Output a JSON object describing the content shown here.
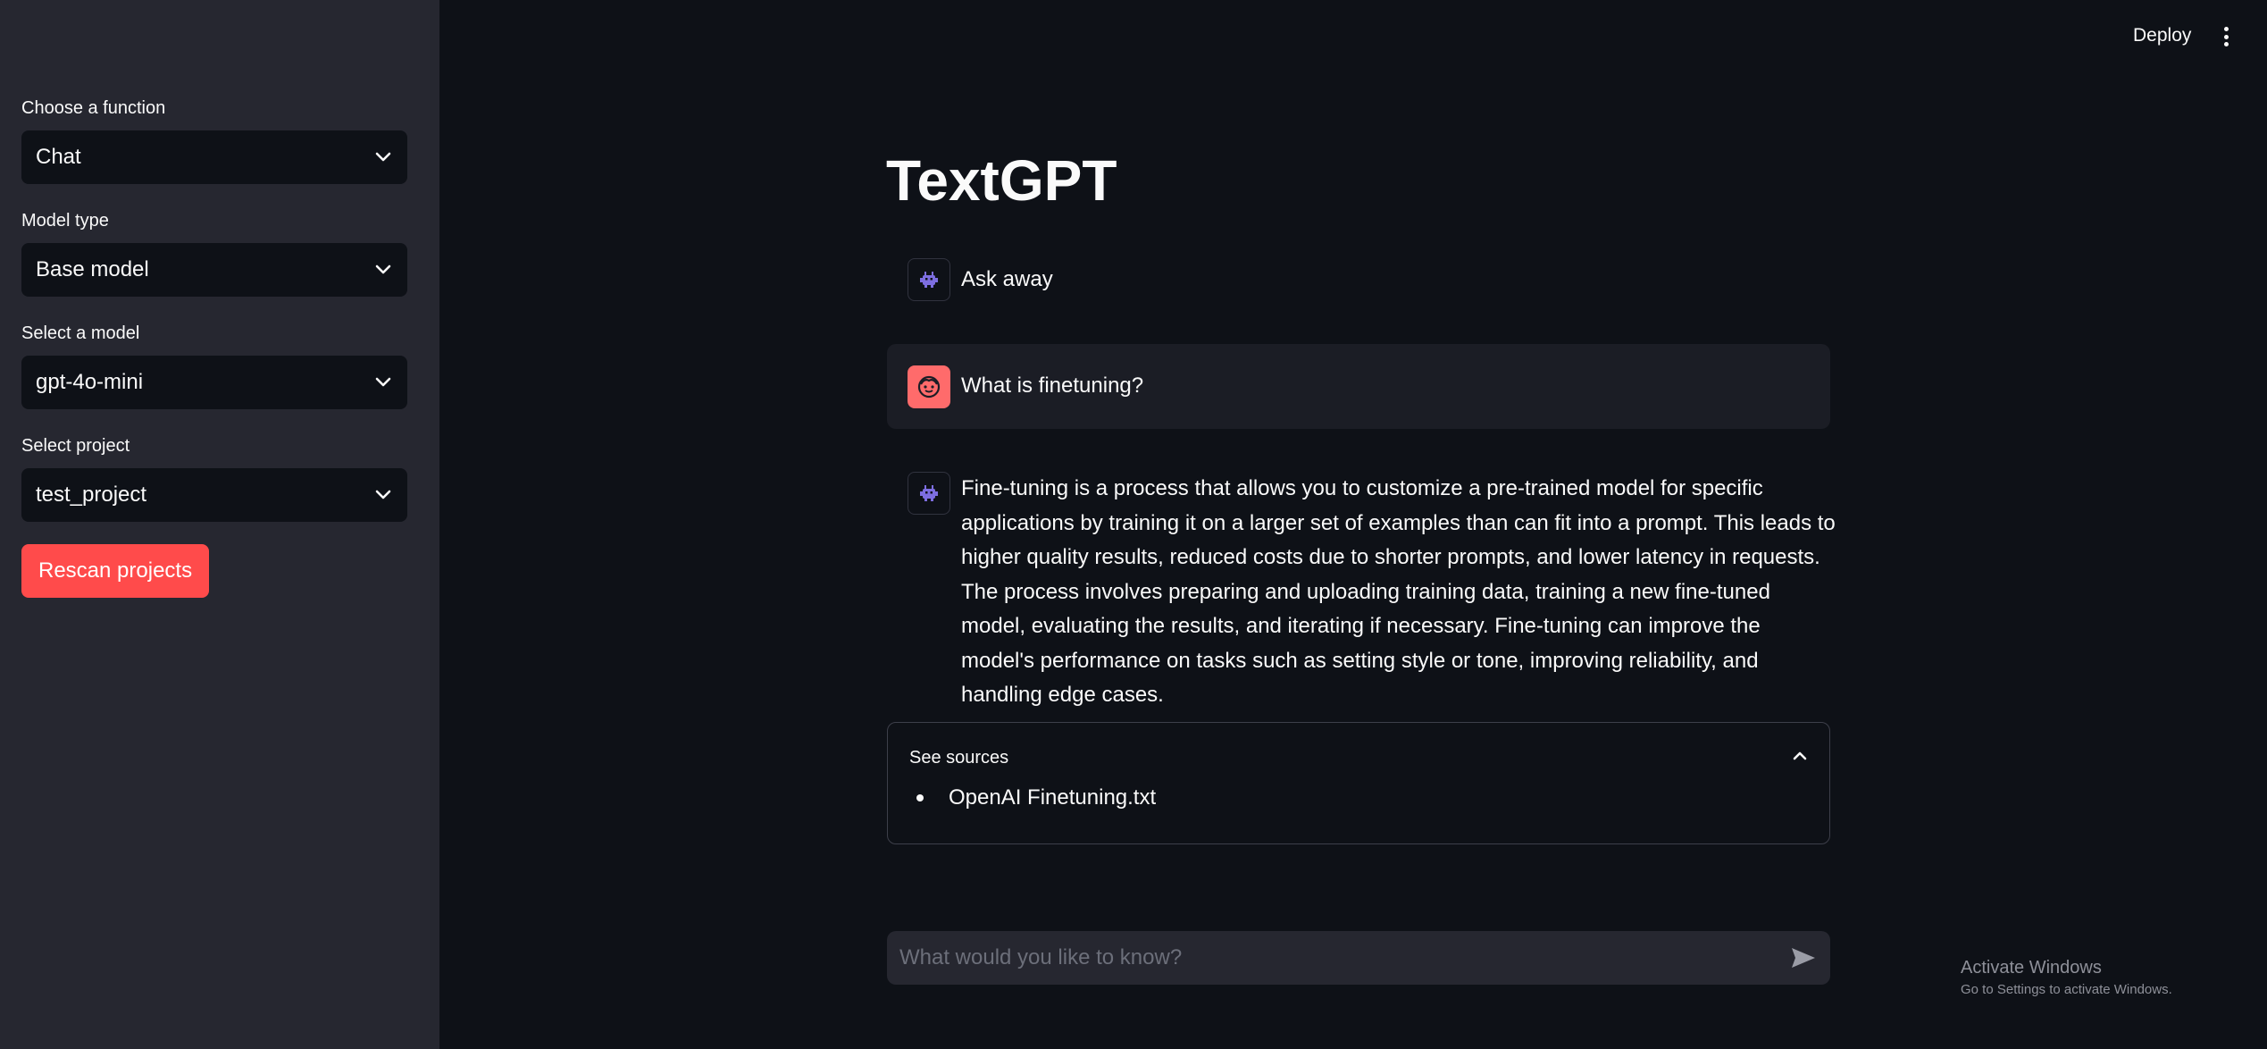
{
  "sidebar": {
    "function": {
      "label": "Choose a function",
      "value": "Chat"
    },
    "model_type": {
      "label": "Model type",
      "value": "Base model"
    },
    "model": {
      "label": "Select a model",
      "value": "gpt-4o-mini"
    },
    "project": {
      "label": "Select project",
      "value": "test_project"
    },
    "rescan_label": "Rescan projects",
    "accent": "#ff4b4b"
  },
  "header": {
    "deploy_label": "Deploy",
    "menu_icon": "kebab-menu-icon"
  },
  "main": {
    "title": "TextGPT",
    "messages": [
      {
        "role": "assistant",
        "icon": "robot-icon",
        "text": "Ask away"
      },
      {
        "role": "user",
        "icon": "user-face-icon",
        "text": "What is finetuning?"
      },
      {
        "role": "assistant",
        "icon": "robot-icon",
        "text": "Fine-tuning is a process that allows you to customize a pre-trained model for specific applications by training it on a larger set of examples than can fit into a prompt. This leads to higher quality results, reduced costs due to shorter prompts, and lower latency in requests. The process involves preparing and uploading training data, training a new fine-tuned model, evaluating the results, and iterating if necessary. Fine-tuning can improve the model's performance on tasks such as setting style or tone, improving reliability, and handling edge cases."
      }
    ],
    "sources": {
      "label": "See sources",
      "expanded": true,
      "items": [
        "OpenAI Finetuning.txt"
      ]
    },
    "chat_input": {
      "placeholder": "What would you like to know?",
      "value": ""
    }
  },
  "watermark": {
    "line1": "Activate Windows",
    "line2": "Go to Settings to activate Windows."
  }
}
